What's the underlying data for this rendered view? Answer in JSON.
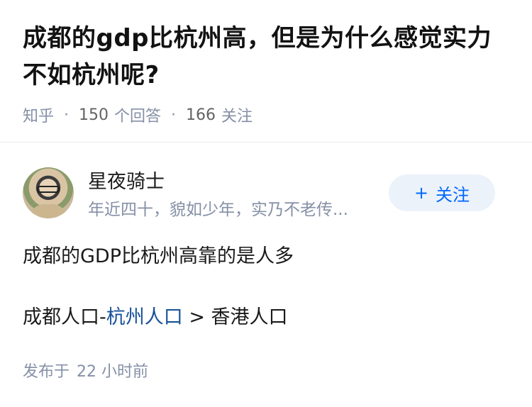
{
  "question": {
    "title": "成都的gdp比杭州高，但是为什么感觉实力不如杭州呢?",
    "source": "知乎",
    "separator": "·",
    "answer_count": "150",
    "answer_label": "个回答",
    "follow_count": "166",
    "follow_label": "关注"
  },
  "author": {
    "name": "星夜骑士",
    "bio": "年近四十，貌如少年，实乃不老传...",
    "follow_button_label": "关注",
    "follow_button_icon": "plus-icon"
  },
  "answer": {
    "line1": "成都的GDP比杭州高靠的是人多",
    "line2_prefix": "成都人口-",
    "line2_link": "杭州人口",
    "line2_suffix": " > 香港人口"
  },
  "footer": {
    "published_label": "发布于",
    "published_time": "22 小时前"
  },
  "colors": {
    "accent": "#0066ff",
    "link": "#175199",
    "muted": "#8590a6",
    "button_bg": "#ebf2fa"
  }
}
